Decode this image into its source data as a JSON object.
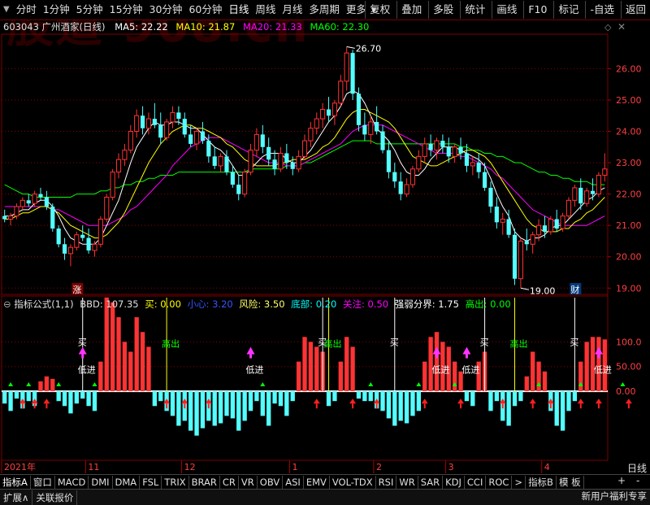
{
  "watermark": "股道 908.cn",
  "toolbar": {
    "left_items": [
      "分时",
      "1分钟",
      "5分钟",
      "15分钟",
      "30分钟",
      "60分钟",
      "日线",
      "周线",
      "月线",
      "多周期",
      "更多"
    ],
    "right_items": [
      "复权",
      "叠加",
      "多股",
      "统计",
      "画线",
      "F10",
      "标记",
      "-自选",
      "返回"
    ]
  },
  "info": {
    "stock": "603043 广州酒家(日线)",
    "ma5": "MA5: 22.22",
    "ma10": "MA10: 21.87",
    "ma20": "MA20: 21.33",
    "ma60": "MA60: 22.30"
  },
  "indicator": {
    "title": "指标公式(1,1)",
    "bbd": "BBD: 107.35",
    "buy": "买: 0.00",
    "careful": "小心: 3.20",
    "risk": "风险: 3.50",
    "bottom": "底部: 0.20",
    "focus": "关注: 0.50",
    "boundary": "强弱分界: 1.75",
    "high_out": "高出: 0.00"
  },
  "colors": {
    "up": "#ff3333",
    "down": "#54ffff",
    "ma5": "#ffffff",
    "ma10": "#ffff00",
    "ma20": "#ff00ff",
    "ma60": "#00ff00",
    "grid": "#8b0000"
  },
  "axis": {
    "price_ticks": [
      "26.00",
      "25.00",
      "24.00",
      "23.00",
      "22.00",
      "21.00",
      "20.00",
      "19.00"
    ],
    "ind_ticks": [
      "100.0",
      "50.00",
      "0.00"
    ],
    "dates": [
      "2021年",
      "11",
      "12",
      "1",
      "2",
      "3",
      "4"
    ],
    "period_label": "日线"
  },
  "markers": {
    "high_label": "26.70",
    "low_label": "19.00",
    "zhang": "涨",
    "cai": "财"
  },
  "signals": {
    "buy": "买",
    "low_in": "低进",
    "high_out": "高出"
  },
  "tabs": [
    "指标A",
    "窗口",
    "MACD",
    "DMI",
    "DMA",
    "FSL",
    "TRIX",
    "BRAR",
    "CR",
    "VR",
    "OBV",
    "ASI",
    "EMV",
    "VOL-TDX",
    "RSI",
    "WR",
    "SAR",
    "KDJ",
    "CCI",
    "ROC"
  ],
  "tab_more": ">",
  "tab_right": [
    "指标B",
    "模 板"
  ],
  "zoom": [
    "+",
    "-"
  ],
  "bottom": {
    "expand": "扩展∧",
    "related": "关联报价",
    "promo": "新用户福利专享"
  },
  "chart_data": {
    "type": "candlestick",
    "price_range": [
      18.8,
      27.1
    ],
    "candles_ohlc": [
      [
        21.3,
        21.5,
        21.1,
        21.2
      ],
      [
        21.2,
        21.4,
        21.0,
        21.3
      ],
      [
        21.3,
        21.7,
        21.2,
        21.6
      ],
      [
        21.6,
        21.9,
        21.5,
        21.8
      ],
      [
        21.8,
        22.0,
        21.6,
        21.7
      ],
      [
        21.7,
        22.1,
        21.6,
        22.0
      ],
      [
        22.0,
        22.2,
        21.8,
        21.9
      ],
      [
        21.9,
        22.1,
        21.5,
        21.6
      ],
      [
        21.6,
        21.7,
        20.8,
        20.9
      ],
      [
        20.9,
        21.0,
        20.3,
        20.4
      ],
      [
        20.4,
        20.6,
        19.9,
        20.1
      ],
      [
        20.1,
        20.4,
        19.7,
        20.3
      ],
      [
        20.3,
        20.8,
        20.2,
        20.7
      ],
      [
        20.7,
        21.0,
        20.5,
        20.6
      ],
      [
        20.6,
        20.9,
        20.1,
        20.2
      ],
      [
        20.2,
        20.5,
        20.0,
        20.4
      ],
      [
        20.4,
        21.3,
        20.3,
        21.2
      ],
      [
        21.2,
        22.0,
        21.1,
        21.9
      ],
      [
        21.9,
        22.8,
        21.8,
        22.7
      ],
      [
        22.7,
        23.3,
        22.5,
        23.1
      ],
      [
        23.1,
        23.6,
        22.9,
        23.4
      ],
      [
        23.4,
        24.2,
        23.3,
        24.0
      ],
      [
        24.0,
        24.7,
        23.8,
        24.5
      ],
      [
        24.5,
        24.8,
        23.9,
        24.1
      ],
      [
        24.1,
        24.6,
        23.9,
        24.4
      ],
      [
        24.4,
        24.9,
        24.1,
        24.2
      ],
      [
        24.2,
        24.6,
        23.6,
        23.8
      ],
      [
        23.8,
        24.4,
        23.7,
        24.3
      ],
      [
        24.3,
        24.8,
        24.1,
        24.6
      ],
      [
        24.6,
        24.8,
        24.2,
        24.4
      ],
      [
        24.4,
        24.6,
        23.8,
        23.9
      ],
      [
        23.9,
        24.2,
        23.5,
        23.6
      ],
      [
        23.6,
        24.1,
        23.4,
        24.0
      ],
      [
        24.0,
        24.3,
        23.6,
        23.7
      ],
      [
        23.7,
        23.9,
        23.0,
        23.2
      ],
      [
        23.2,
        23.5,
        22.8,
        22.9
      ],
      [
        22.9,
        23.3,
        22.7,
        23.2
      ],
      [
        23.2,
        23.4,
        22.6,
        22.7
      ],
      [
        22.7,
        22.9,
        22.2,
        22.3
      ],
      [
        22.3,
        22.6,
        21.8,
        22.0
      ],
      [
        22.0,
        22.8,
        21.9,
        22.7
      ],
      [
        22.7,
        23.6,
        22.6,
        23.4
      ],
      [
        23.4,
        24.1,
        23.2,
        23.9
      ],
      [
        23.9,
        24.2,
        23.3,
        23.5
      ],
      [
        23.5,
        23.8,
        22.9,
        23.1
      ],
      [
        23.1,
        23.4,
        22.6,
        22.8
      ],
      [
        22.8,
        23.5,
        22.7,
        23.3
      ],
      [
        23.3,
        23.6,
        22.8,
        23.0
      ],
      [
        23.0,
        23.2,
        22.6,
        22.8
      ],
      [
        22.8,
        23.4,
        22.7,
        23.2
      ],
      [
        23.2,
        23.9,
        23.1,
        23.7
      ],
      [
        23.7,
        24.3,
        23.5,
        24.1
      ],
      [
        24.1,
        24.6,
        23.9,
        24.4
      ],
      [
        24.4,
        24.9,
        24.1,
        24.7
      ],
      [
        24.7,
        25.1,
        24.3,
        24.5
      ],
      [
        24.5,
        25.0,
        24.2,
        24.9
      ],
      [
        24.9,
        25.8,
        24.8,
        25.6
      ],
      [
        25.6,
        26.7,
        25.3,
        26.5
      ],
      [
        26.5,
        26.6,
        25.0,
        25.2
      ],
      [
        25.2,
        25.4,
        24.0,
        24.2
      ],
      [
        24.2,
        24.6,
        23.7,
        23.9
      ],
      [
        23.9,
        24.5,
        23.6,
        24.3
      ],
      [
        24.3,
        24.8,
        23.9,
        24.0
      ],
      [
        24.0,
        24.2,
        23.3,
        23.4
      ],
      [
        23.4,
        23.7,
        22.5,
        22.7
      ],
      [
        22.7,
        23.0,
        22.2,
        22.4
      ],
      [
        22.4,
        22.7,
        21.8,
        22.0
      ],
      [
        22.0,
        22.5,
        21.9,
        22.3
      ],
      [
        22.3,
        22.9,
        22.2,
        22.8
      ],
      [
        22.8,
        23.4,
        22.7,
        23.2
      ],
      [
        23.2,
        23.8,
        23.0,
        23.6
      ],
      [
        23.6,
        23.9,
        23.2,
        23.4
      ],
      [
        23.4,
        23.8,
        23.1,
        23.7
      ],
      [
        23.7,
        23.9,
        23.3,
        23.5
      ],
      [
        23.5,
        23.8,
        23.0,
        23.2
      ],
      [
        23.2,
        23.6,
        23.0,
        23.5
      ],
      [
        23.5,
        23.8,
        23.1,
        23.3
      ],
      [
        23.3,
        23.6,
        22.7,
        22.9
      ],
      [
        22.9,
        23.2,
        22.6,
        23.0
      ],
      [
        23.0,
        23.3,
        22.5,
        22.7
      ],
      [
        22.7,
        23.0,
        22.1,
        22.2
      ],
      [
        22.2,
        22.4,
        21.4,
        21.6
      ],
      [
        21.6,
        21.9,
        20.9,
        21.1
      ],
      [
        21.1,
        21.4,
        20.7,
        21.2
      ],
      [
        21.2,
        21.5,
        20.6,
        20.7
      ],
      [
        20.7,
        20.9,
        19.1,
        19.3
      ],
      [
        19.3,
        20.6,
        19.0,
        20.5
      ],
      [
        20.5,
        20.9,
        20.2,
        20.4
      ],
      [
        20.4,
        20.8,
        20.1,
        20.7
      ],
      [
        20.7,
        21.2,
        20.5,
        21.0
      ],
      [
        21.0,
        21.3,
        20.6,
        20.8
      ],
      [
        20.8,
        21.3,
        20.7,
        21.2
      ],
      [
        21.2,
        21.5,
        20.8,
        20.9
      ],
      [
        20.9,
        21.4,
        20.8,
        21.3
      ],
      [
        21.3,
        21.9,
        21.2,
        21.8
      ],
      [
        21.8,
        22.3,
        21.6,
        22.2
      ],
      [
        22.2,
        22.5,
        21.5,
        21.7
      ],
      [
        21.7,
        22.2,
        21.6,
        22.1
      ],
      [
        22.1,
        22.5,
        21.8,
        22.0
      ],
      [
        22.0,
        22.7,
        21.9,
        22.6
      ],
      [
        22.6,
        23.3,
        22.4,
        22.8
      ]
    ],
    "ma5": [
      21.3,
      21.3,
      21.4,
      21.5,
      21.5,
      21.7,
      21.8,
      21.8,
      21.6,
      21.3,
      20.9,
      20.6,
      20.5,
      20.4,
      20.4,
      20.4,
      20.6,
      21.0,
      21.4,
      21.8,
      22.4,
      23.0,
      23.5,
      23.8,
      24.1,
      24.3,
      24.2,
      24.2,
      24.3,
      24.3,
      24.2,
      24.1,
      24.1,
      23.9,
      23.7,
      23.5,
      23.4,
      23.2,
      22.9,
      22.6,
      22.6,
      22.8,
      23.0,
      23.2,
      23.3,
      23.3,
      23.3,
      23.1,
      23.0,
      23.0,
      23.2,
      23.4,
      23.7,
      24.0,
      24.3,
      24.5,
      24.8,
      25.2,
      25.3,
      25.2,
      24.9,
      24.5,
      24.1,
      23.9,
      23.7,
      23.4,
      23.0,
      22.7,
      22.6,
      22.6,
      22.8,
      23.1,
      23.3,
      23.5,
      23.5,
      23.5,
      23.4,
      23.3,
      23.2,
      23.1,
      22.9,
      22.5,
      22.0,
      21.6,
      21.3,
      20.8,
      20.6,
      20.5,
      20.6,
      20.6,
      20.7,
      20.9,
      21.0,
      21.0,
      21.2,
      21.4,
      21.6,
      21.8,
      21.9,
      22.1,
      22.2
    ],
    "ma10": [
      21.2,
      21.2,
      21.3,
      21.4,
      21.4,
      21.5,
      21.6,
      21.6,
      21.5,
      21.4,
      21.2,
      21.0,
      20.9,
      20.8,
      20.7,
      20.6,
      20.6,
      20.7,
      20.9,
      21.1,
      21.4,
      21.8,
      22.2,
      22.6,
      23.0,
      23.3,
      23.6,
      23.8,
      24.0,
      24.1,
      24.2,
      24.2,
      24.1,
      24.1,
      24.0,
      23.9,
      23.8,
      23.6,
      23.5,
      23.3,
      23.1,
      23.0,
      22.9,
      22.9,
      22.9,
      22.9,
      23.0,
      23.0,
      23.1,
      23.1,
      23.1,
      23.2,
      23.3,
      23.5,
      23.6,
      23.8,
      24.1,
      24.4,
      24.6,
      24.7,
      24.7,
      24.6,
      24.5,
      24.4,
      24.3,
      24.1,
      23.8,
      23.5,
      23.2,
      23.1,
      23.0,
      22.9,
      22.9,
      23.0,
      23.1,
      23.2,
      23.3,
      23.4,
      23.4,
      23.3,
      23.2,
      23.0,
      22.7,
      22.4,
      22.1,
      21.8,
      21.5,
      21.2,
      21.0,
      20.9,
      20.8,
      20.8,
      20.8,
      20.9,
      20.9,
      21.1,
      21.2,
      21.4,
      21.5,
      21.7,
      21.9
    ],
    "ma20": [
      21.6,
      21.6,
      21.6,
      21.6,
      21.6,
      21.6,
      21.6,
      21.6,
      21.5,
      21.5,
      21.4,
      21.3,
      21.2,
      21.1,
      21.0,
      21.0,
      21.0,
      21.0,
      21.1,
      21.2,
      21.3,
      21.5,
      21.6,
      21.8,
      22.0,
      22.2,
      22.4,
      22.6,
      22.9,
      23.1,
      23.3,
      23.5,
      23.6,
      23.7,
      23.8,
      23.8,
      23.8,
      23.7,
      23.6,
      23.5,
      23.4,
      23.3,
      23.2,
      23.1,
      23.0,
      23.0,
      23.0,
      22.9,
      22.9,
      22.9,
      23.0,
      23.1,
      23.2,
      23.3,
      23.4,
      23.5,
      23.6,
      23.8,
      24.0,
      24.1,
      24.2,
      24.2,
      24.2,
      24.2,
      24.1,
      24.0,
      23.9,
      23.8,
      23.7,
      23.6,
      23.5,
      23.4,
      23.3,
      23.3,
      23.3,
      23.3,
      23.2,
      23.2,
      23.1,
      23.0,
      22.9,
      22.8,
      22.6,
      22.5,
      22.3,
      22.1,
      21.9,
      21.7,
      21.5,
      21.4,
      21.3,
      21.2,
      21.1,
      21.0,
      21.0,
      21.0,
      21.0,
      21.0,
      21.1,
      21.2,
      21.3
    ],
    "ma60": [
      22.3,
      22.2,
      22.1,
      22.0,
      22.0,
      21.9,
      21.9,
      21.9,
      21.9,
      21.9,
      21.9,
      21.9,
      22.0,
      22.0,
      22.0,
      22.0,
      22.1,
      22.1,
      22.2,
      22.2,
      22.3,
      22.3,
      22.4,
      22.4,
      22.5,
      22.5,
      22.6,
      22.6,
      22.6,
      22.7,
      22.7,
      22.7,
      22.7,
      22.7,
      22.7,
      22.7,
      22.7,
      22.7,
      22.7,
      22.7,
      22.7,
      22.8,
      22.8,
      22.8,
      22.8,
      22.8,
      22.8,
      22.9,
      22.9,
      22.9,
      23.0,
      23.0,
      23.1,
      23.2,
      23.3,
      23.4,
      23.5,
      23.6,
      23.7,
      23.7,
      23.7,
      23.7,
      23.6,
      23.6,
      23.6,
      23.6,
      23.6,
      23.6,
      23.6,
      23.6,
      23.6,
      23.6,
      23.6,
      23.6,
      23.6,
      23.6,
      23.5,
      23.5,
      23.4,
      23.4,
      23.3,
      23.3,
      23.2,
      23.2,
      23.1,
      23.0,
      23.0,
      22.9,
      22.8,
      22.7,
      22.7,
      22.6,
      22.6,
      22.5,
      22.5,
      22.4,
      22.4,
      22.4,
      22.3,
      22.3,
      22.3
    ],
    "bbd": [
      -25,
      -40,
      -15,
      -35,
      -20,
      -30,
      20,
      30,
      25,
      -20,
      -30,
      -45,
      -25,
      -15,
      -30,
      -40,
      60,
      190,
      180,
      150,
      100,
      80,
      150,
      120,
      90,
      -30,
      -20,
      -40,
      -50,
      -70,
      -60,
      -80,
      -90,
      -75,
      -60,
      -70,
      -65,
      -50,
      -55,
      -80,
      -60,
      -40,
      -20,
      -50,
      -70,
      -25,
      -30,
      -50,
      -20,
      60,
      110,
      100,
      90,
      80,
      -30,
      -20,
      60,
      110,
      90,
      -15,
      -20,
      -20,
      -35,
      -40,
      -55,
      -70,
      -60,
      -65,
      -50,
      -40,
      60,
      110,
      120,
      100,
      90,
      60,
      40,
      -20,
      -30,
      60,
      80,
      -40,
      -20,
      -60,
      -70,
      -30,
      -20,
      30,
      80,
      60,
      40,
      -40,
      -70,
      -80,
      -40,
      -20,
      60,
      100,
      110,
      110,
      105
    ],
    "ylim_bbd": [
      -140,
      160
    ],
    "buy_idx": [
      13,
      53,
      65,
      80,
      95
    ],
    "low_in_idx": [
      13,
      41,
      72,
      77,
      99
    ],
    "high_out_idx": [
      27,
      54,
      85
    ],
    "pink_up_idx": [
      13,
      41,
      72,
      77,
      99
    ],
    "red_arrow_idx": [
      3,
      5,
      7,
      27,
      30,
      34,
      52,
      58,
      62,
      70,
      76,
      83,
      88,
      91,
      96,
      99,
      104
    ],
    "green_arrow_idx": [
      1,
      4,
      9,
      15,
      43,
      61,
      69,
      75,
      89,
      96,
      103
    ]
  }
}
